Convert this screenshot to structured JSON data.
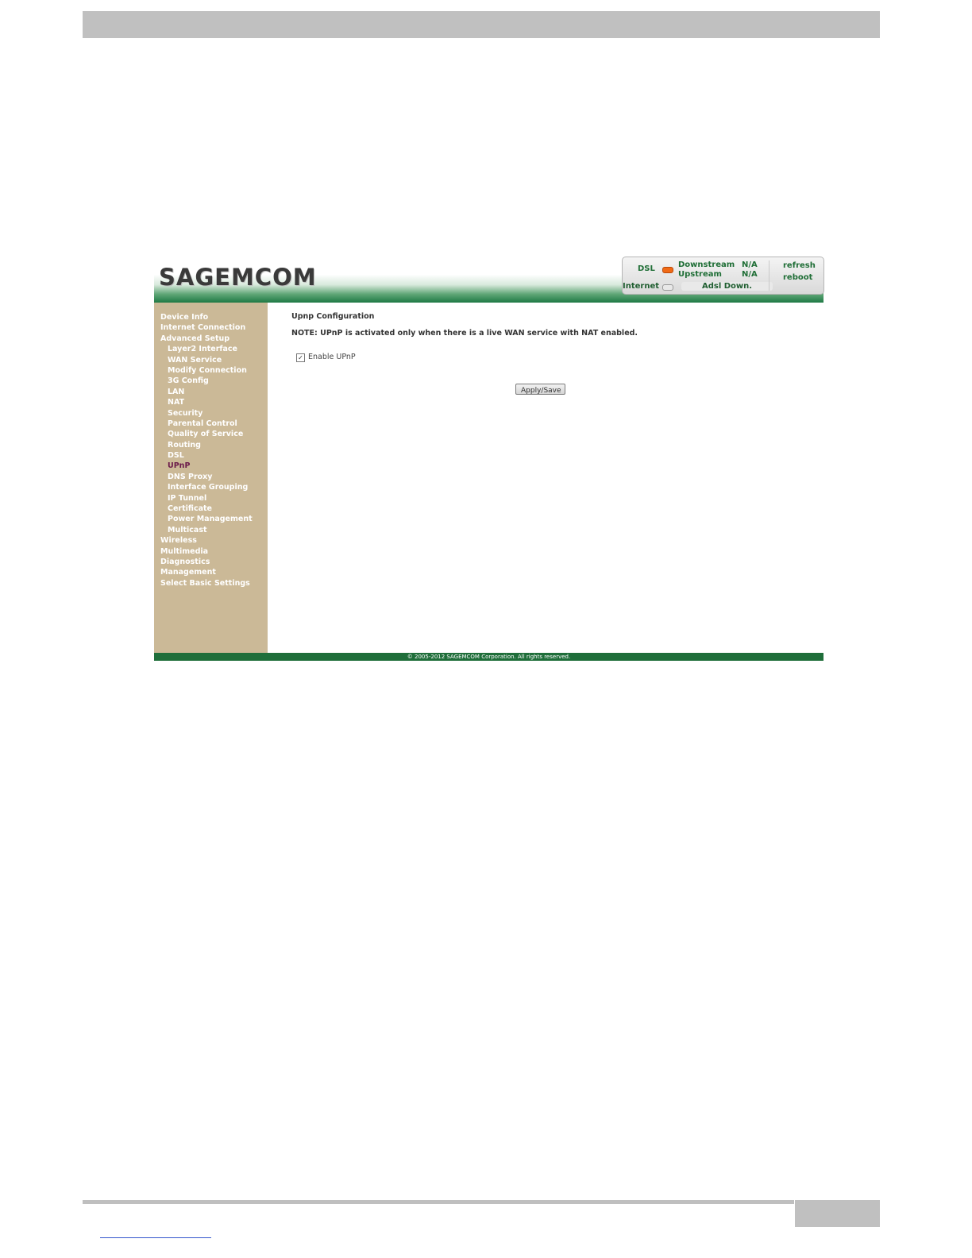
{
  "brand": {
    "logo_text": "SAGEMCOM"
  },
  "status": {
    "dsl_label": "DSL",
    "downstream_label": "Downstream",
    "upstream_label": "Upstream",
    "downstream_value": "N/A",
    "upstream_value": "N/A",
    "internet_label": "Internet",
    "adsl_status": "Adsl Down.",
    "refresh_label": "refresh",
    "reboot_label": "reboot",
    "dsl_led_color": "#f06a16"
  },
  "sidebar": {
    "items": [
      {
        "label": "Device Info",
        "level": 1
      },
      {
        "label": "Internet Connection",
        "level": 1
      },
      {
        "label": "Advanced Setup",
        "level": 1
      },
      {
        "label": "Layer2 Interface",
        "level": 2
      },
      {
        "label": "WAN Service",
        "level": 2
      },
      {
        "label": "Modify Connection",
        "level": 2
      },
      {
        "label": "3G Config",
        "level": 2
      },
      {
        "label": "LAN",
        "level": 2
      },
      {
        "label": "NAT",
        "level": 2
      },
      {
        "label": "Security",
        "level": 2
      },
      {
        "label": "Parental Control",
        "level": 2
      },
      {
        "label": "Quality of Service",
        "level": 2
      },
      {
        "label": "Routing",
        "level": 2
      },
      {
        "label": "DSL",
        "level": 2
      },
      {
        "label": "UPnP",
        "level": 2,
        "active": true
      },
      {
        "label": "DNS Proxy",
        "level": 2
      },
      {
        "label": "Interface Grouping",
        "level": 2
      },
      {
        "label": "IP Tunnel",
        "level": 2
      },
      {
        "label": "Certificate",
        "level": 2
      },
      {
        "label": "Power Management",
        "level": 2
      },
      {
        "label": "Multicast",
        "level": 2
      },
      {
        "label": "Wireless",
        "level": 1
      },
      {
        "label": "Multimedia",
        "level": 1
      },
      {
        "label": "Diagnostics",
        "level": 1
      },
      {
        "label": "Management",
        "level": 1
      },
      {
        "label": "Select Basic Settings",
        "level": 1
      }
    ]
  },
  "main": {
    "title": "Upnp Configuration",
    "note": "NOTE: UPnP is activated only when there is a live WAN service with NAT enabled.",
    "enable_label": "Enable UPnP",
    "enable_checked": true,
    "checkmark": "✓",
    "apply_label": "Apply/Save"
  },
  "footer": {
    "copyright": "© 2005-2012 SAGEMCOM Corporation. All rights reserved."
  },
  "colors": {
    "brand_green": "#1f6e3a",
    "sidebar_bg": "#cbb997",
    "active_item": "#6b1a4a"
  }
}
